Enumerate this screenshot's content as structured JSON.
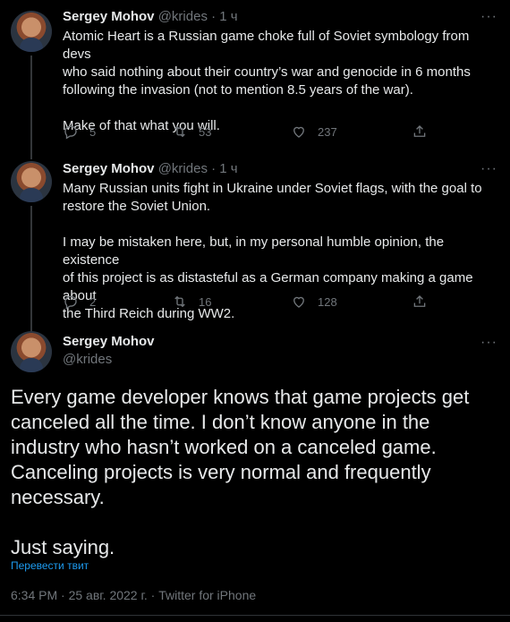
{
  "tweets": [
    {
      "name": "Sergey Mohov",
      "handle": "@krides",
      "sep": "·",
      "time": "1 ч",
      "more": "···",
      "text": "Atomic Heart is a Russian game choke full of Soviet symbology from devs\nwho said nothing about their country’s war and genocide in 6 months\nfollowing the invasion (not to mention 8.5 years of the war).\n\nMake of that what you will.",
      "replies": "5",
      "retweets": "53",
      "likes": "237"
    },
    {
      "name": "Sergey Mohov",
      "handle": "@krides",
      "sep": "·",
      "time": "1 ч",
      "more": "···",
      "text": "Many Russian units fight in Ukraine under Soviet flags, with the goal to\nrestore the Soviet Union.\n\nI may be mistaken here, but, in my personal humble opinion, the existence\nof this project is as distasteful as a German company making a game about\nthe Third Reich during WW2.",
      "replies": "2",
      "retweets": "16",
      "likes": "128"
    }
  ],
  "main": {
    "name": "Sergey Mohov",
    "handle": "@krides",
    "more": "···",
    "text": "Every game developer knows that game projects get\ncanceled all the time. I don’t know anyone in the\nindustry who hasn’t worked on a canceled game.\nCanceling projects is very normal and frequently\nnecessary.\n\nJust saying.",
    "translate": "Перевести твит",
    "meta": "6:34 PM · 25 авг. 2022 г. · Twitter for iPhone"
  },
  "colors": {
    "background": "#000000",
    "text": "#e7e9ea",
    "secondary": "#71767b",
    "link": "#1d9bf0"
  }
}
